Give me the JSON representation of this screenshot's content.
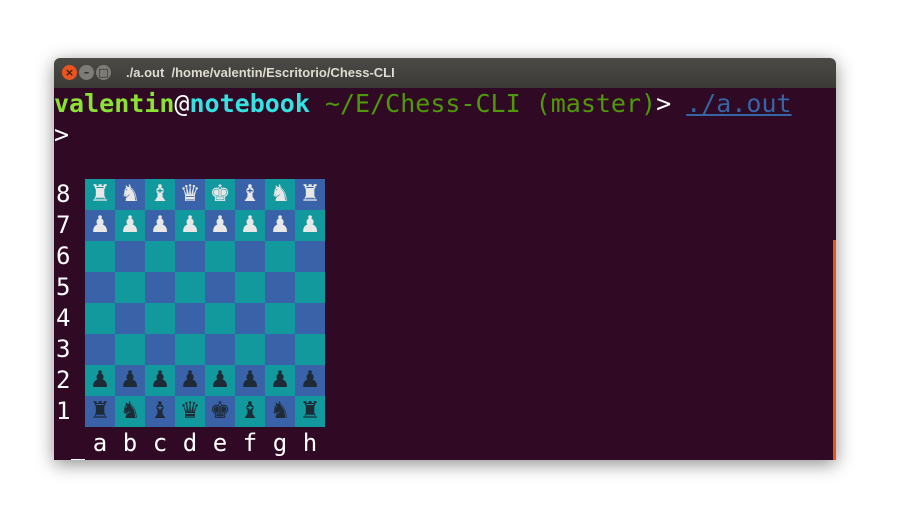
{
  "window": {
    "title": "./a.out  /home/valentin/Escritorio/Chess-CLI",
    "close_glyph": "×",
    "minimize_glyph": "–",
    "maximize_glyph": "□"
  },
  "prompt": {
    "user": "valentin",
    "at": "@",
    "host": "notebook",
    "path": " ~/E/Chess-CLI (master)",
    "symbol": "> ",
    "command": "./a.out"
  },
  "output": {
    "first_prompt": ">",
    "last_prompt": ">"
  },
  "board": {
    "ranks": [
      "8",
      "7",
      "6",
      "5",
      "4",
      "3",
      "2",
      "1"
    ],
    "files": [
      "a",
      "b",
      "c",
      "d",
      "e",
      "f",
      "g",
      "h"
    ],
    "squares": [
      [
        "♜",
        "♞",
        "♝",
        "♛",
        "♚",
        "♝",
        "♞",
        "♜"
      ],
      [
        "♟",
        "♟",
        "♟",
        "♟",
        "♟",
        "♟",
        "♟",
        "♟"
      ],
      [
        "",
        "",
        "",
        "",
        "",
        "",
        "",
        ""
      ],
      [
        "",
        "",
        "",
        "",
        "",
        "",
        "",
        ""
      ],
      [
        "",
        "",
        "",
        "",
        "",
        "",
        "",
        ""
      ],
      [
        "",
        "",
        "",
        "",
        "",
        "",
        "",
        ""
      ],
      [
        "♟",
        "♟",
        "♟",
        "♟",
        "♟",
        "♟",
        "♟",
        "♟"
      ],
      [
        "♜",
        "♞",
        "♝",
        "♛",
        "♚",
        "♝",
        "♞",
        "♜"
      ]
    ],
    "piece_sides": [
      "white",
      "white",
      "",
      "",
      "",
      "",
      "black",
      "black"
    ],
    "colors": {
      "light_square": "#11999e",
      "dark_square": "#3a62a9",
      "white_piece": "#e8e8e8",
      "black_piece": "#1e2a36"
    }
  },
  "colors": {
    "terminal_bg": "#300a24",
    "user": "#8ae234",
    "host": "#34e2e2",
    "path": "#4e9a06",
    "command": "#3465a4"
  }
}
